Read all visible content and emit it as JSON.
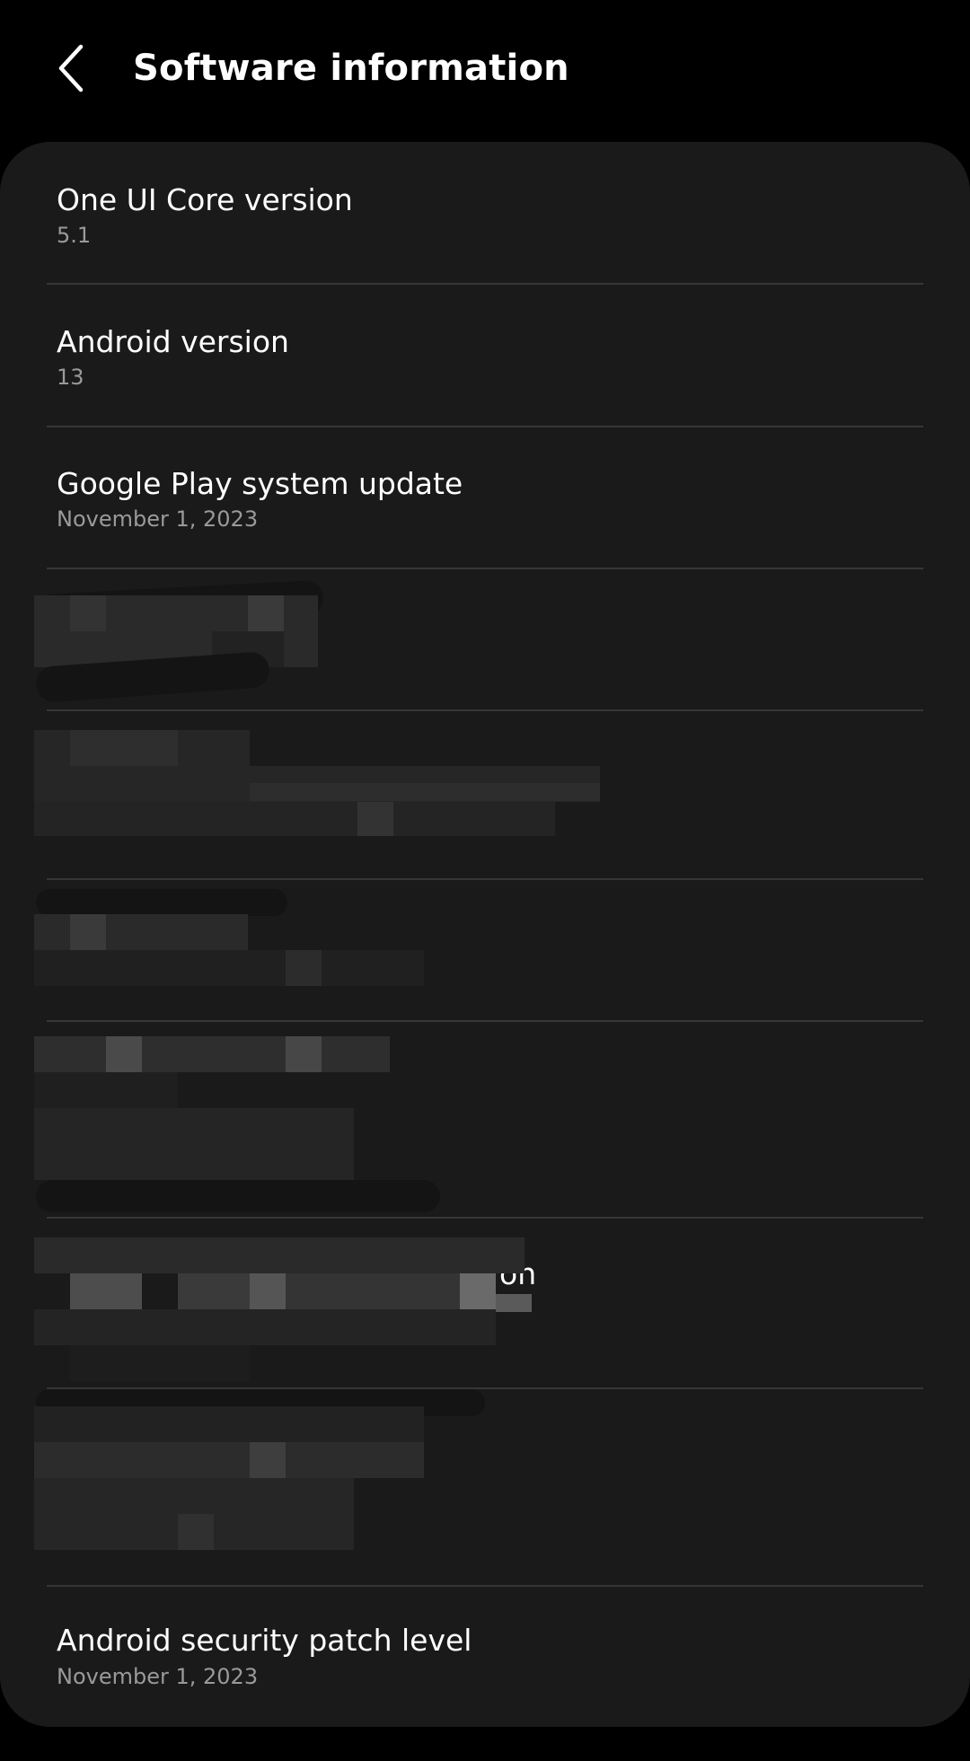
{
  "header": {
    "title": "Software information",
    "back_icon": "chevron-left-icon"
  },
  "items": [
    {
      "title": "One UI Core version",
      "summary": "5.1"
    },
    {
      "title": "Android version",
      "summary": "13"
    },
    {
      "title": "Google Play system update",
      "summary": "November 1, 2023"
    },
    {
      "title": "Android security patch level",
      "summary": "November 1, 2023"
    }
  ],
  "redacted_fragments": {
    "item8_tail": "on"
  },
  "colors": {
    "background": "#000000",
    "card": "#1a1a1a",
    "divider": "#363636",
    "title_text": "#ffffff",
    "summary_text": "#9a9a9a"
  }
}
